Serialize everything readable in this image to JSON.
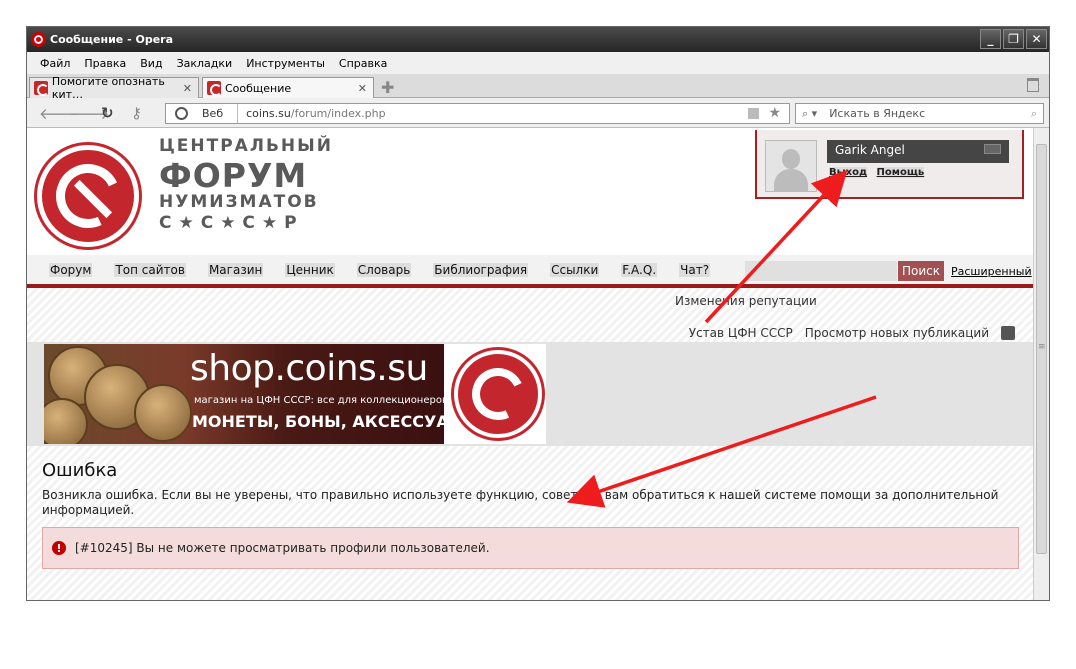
{
  "window": {
    "title": "Сообщение - Opera",
    "controls": [
      "_",
      "❐",
      "✕"
    ]
  },
  "menu": [
    "Файл",
    "Правка",
    "Вид",
    "Закладки",
    "Инструменты",
    "Справка"
  ],
  "tabs": [
    {
      "label": "Помогите опознать кит…",
      "close": "✕"
    },
    {
      "label": "Сообщение",
      "close": "✕"
    }
  ],
  "addr": {
    "mode": "Веб",
    "url_host": "coins.su",
    "url_path": "/forum/index.php"
  },
  "search": {
    "placeholder": "Искать в Яндекс"
  },
  "brand": {
    "line1": "ЦЕНТРАЛЬНЫЙ",
    "line2": "ФОРУМ",
    "line3": "НУМИЗМАТОВ",
    "line4": "С★С★С★Р"
  },
  "user": {
    "name": "Garik Angel",
    "links": [
      "Выход",
      "Помощь"
    ]
  },
  "nav": [
    "Форум",
    "Топ сайтов",
    "Магазин",
    "Ценник",
    "Словарь",
    "Библиография",
    "Ссылки",
    "F.A.Q.",
    "Чат?"
  ],
  "sitesearch": {
    "button": "Поиск",
    "advanced": "Расширенный"
  },
  "rep": "Изменения репутации",
  "links": [
    "Устав ЦФН СССР",
    "Просмотр новых публикаций"
  ],
  "banner": {
    "title": "shop.coins.su",
    "sub": "магазин на ЦФН СССР: все для коллекционеров",
    "big": "МОНЕТЫ, БОНЫ, АКСЕССУАРЫ"
  },
  "error": {
    "title": "Ошибка",
    "text": "Возникла ошибка. Если вы не уверены, что правильно используете функцию, советуем вам обратиться к нашей системе помощи за дополнительной информацией.",
    "icon": "!",
    "message": "[#10245] Вы не можете просматривать профили пользователей."
  }
}
